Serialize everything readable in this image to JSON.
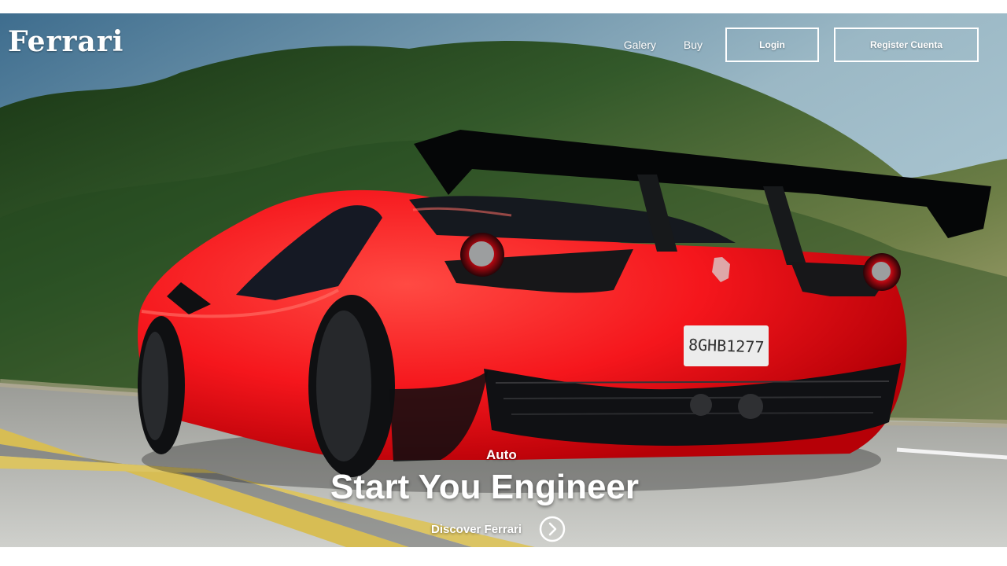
{
  "brand": {
    "logo_text": "Ferrari"
  },
  "nav": {
    "links": [
      {
        "label": "Galery"
      },
      {
        "label": "Buy"
      }
    ],
    "login_label": "Login",
    "register_label": "Register Cuenta"
  },
  "hero": {
    "eyebrow": "Auto",
    "headline": "Start You Engineer",
    "cta_label": "Discover Ferrari",
    "cta_icon": "chevron-right-circle-icon",
    "plate_text": "8GHB1277"
  },
  "colors": {
    "car_red": "#f5161c",
    "text": "#ffffff",
    "button_border": "#ffffff"
  }
}
